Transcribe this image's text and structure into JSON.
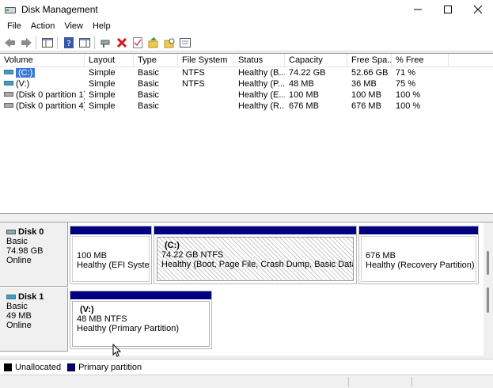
{
  "window": {
    "title": "Disk Management",
    "controls": [
      "minimize",
      "maximize",
      "close"
    ]
  },
  "menu": [
    "File",
    "Action",
    "View",
    "Help"
  ],
  "toolbar": {
    "icons": [
      "back-icon",
      "forward-icon",
      "show-hide-console-tree-icon",
      "help-icon",
      "show-hide-action-pane-icon",
      "connect-virtual-disk-icon",
      "delete-icon",
      "check-icon",
      "folder-up-icon",
      "folder-search-icon",
      "properties-icon"
    ]
  },
  "volumes": {
    "columns": [
      "Volume",
      "Layout",
      "Type",
      "File System",
      "Status",
      "Capacity",
      "Free Spa...",
      "% Free",
      ""
    ],
    "rows": [
      {
        "volume": "(C:)",
        "layout": "Simple",
        "type": "Basic",
        "fs": "NTFS",
        "status": "Healthy (B...",
        "capacity": "74.22 GB",
        "free": "52.66 GB",
        "pct": "71 %"
      },
      {
        "volume": "(V:)",
        "layout": "Simple",
        "type": "Basic",
        "fs": "NTFS",
        "status": "Healthy (P...",
        "capacity": "48 MB",
        "free": "36 MB",
        "pct": "75 %"
      },
      {
        "volume": "(Disk 0 partition 1)",
        "layout": "Simple",
        "type": "Basic",
        "fs": "",
        "status": "Healthy (E...",
        "capacity": "100 MB",
        "free": "100 MB",
        "pct": "100 %"
      },
      {
        "volume": "(Disk 0 partition 4)",
        "layout": "Simple",
        "type": "Basic",
        "fs": "",
        "status": "Healthy (R...",
        "capacity": "676 MB",
        "free": "676 MB",
        "pct": "100 %"
      }
    ]
  },
  "disks": [
    {
      "name": "Disk 0",
      "kind": "Basic",
      "size": "74.98 GB",
      "state": "Online",
      "partitions": [
        {
          "line1": "",
          "line2": "100 MB",
          "line3": "Healthy (EFI System P"
        },
        {
          "line1": "(C:)",
          "line2": "74.22 GB NTFS",
          "line3": "Healthy (Boot, Page File, Crash Dump, Basic Data Partitic"
        },
        {
          "line1": "",
          "line2": "676 MB",
          "line3": "Healthy (Recovery Partition)"
        }
      ]
    },
    {
      "name": "Disk 1",
      "kind": "Basic",
      "size": "49 MB",
      "state": "Online",
      "partitions": [
        {
          "line1": "(V:)",
          "line2": "48 MB NTFS",
          "line3": "Healthy (Primary Partition)"
        }
      ]
    }
  ],
  "legend": [
    {
      "label": "Unallocated",
      "color": "#000000"
    },
    {
      "label": "Primary partition",
      "color": "#000080"
    }
  ],
  "colors": {
    "primary_bar": "#000080",
    "selection": "#3c78d8"
  }
}
